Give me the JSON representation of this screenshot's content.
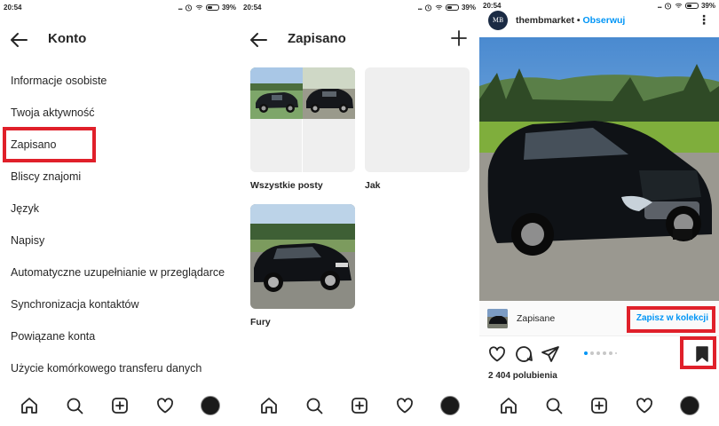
{
  "status_bar": {
    "time": "20:54",
    "signal_dots": "...",
    "battery": "39%"
  },
  "panel1": {
    "title": "Konto",
    "menu": [
      "Informacje osobiste",
      "Twoja aktywność",
      "Zapisano",
      "Bliscy znajomi",
      "Język",
      "Napisy",
      "Automatyczne uzupełnianie w przeglądarce",
      "Synchronizacja kontaktów",
      "Powiązane konta",
      "Użycie komórkowego transferu danych"
    ]
  },
  "panel2": {
    "title": "Zapisano",
    "collections": [
      {
        "label": "Wszystkie posty"
      },
      {
        "label": "Jak"
      },
      {
        "label": "Fury"
      }
    ]
  },
  "panel3": {
    "avatar_text": "MB",
    "username": "thembmarket",
    "separator": " • ",
    "follow": "Obserwuj",
    "saved_label": "Zapisane",
    "save_to_collection": "Zapisz w kolekcji",
    "likes": "2 404 polubienia",
    "carousel": {
      "count": 6,
      "active": 0
    }
  },
  "icons": {
    "nav": [
      "home-icon",
      "search-icon",
      "new-post-icon",
      "heart-icon",
      "profile-avatar"
    ],
    "actions": [
      "heart-icon",
      "comment-icon",
      "share-icon",
      "bookmark-filled-icon"
    ]
  },
  "colors": {
    "highlight": "#e0202a",
    "link": "#0095f6",
    "text": "#262626"
  }
}
